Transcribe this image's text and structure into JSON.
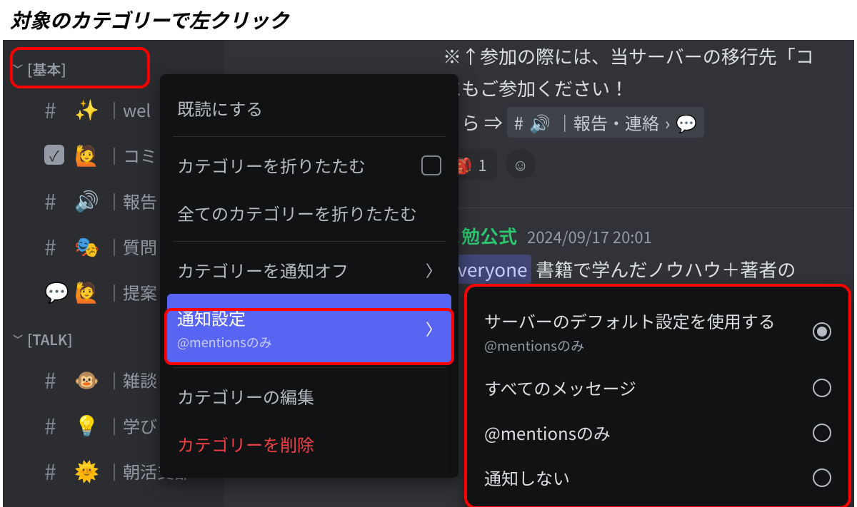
{
  "instruction": "対象のカテゴリーで左クリック",
  "sidebar": {
    "categories": [
      {
        "name": "[基本]",
        "channels": [
          {
            "type": "hash",
            "emoji": "✨",
            "label": "wel"
          },
          {
            "type": "check",
            "emoji": "🙋",
            "label": "コミ"
          },
          {
            "type": "hash",
            "emoji": "🔊",
            "label": "報告"
          },
          {
            "type": "hash",
            "emoji": "🎭",
            "label": "質問"
          },
          {
            "type": "thread",
            "emoji": "🙋",
            "label": "提案"
          }
        ]
      },
      {
        "name": "[TALK]",
        "channels": [
          {
            "type": "hash",
            "emoji": "🐵",
            "label": "雑談"
          },
          {
            "type": "hash",
            "emoji": "💡",
            "label": "学び"
          },
          {
            "type": "hash",
            "emoji": "🌞",
            "label": "朝活支部"
          }
        ]
      }
    ]
  },
  "context_menu": {
    "mark_read": "既読にする",
    "collapse_category": "カテゴリーを折りたたむ",
    "collapse_all": "全てのカテゴリーを折りたたむ",
    "mute_category": "カテゴリーを通知オフ",
    "notification_settings": {
      "title": "通知設定",
      "sub": "@mentionsのみ"
    },
    "edit_category": "カテゴリーの編集",
    "delete_category": "カテゴリーを削除"
  },
  "chat": {
    "line1": "※↑参加の際には、当サーバーの移行先「コ",
    "line2": "にもご参加ください！",
    "line3_prefix": "ちら ⇒",
    "mention_channel": "｜報告・連絡",
    "reaction_count": "1",
    "msg_author": "ュ勉公式",
    "msg_time": "2024/09/17 20:01",
    "msg_mention": "everyone",
    "msg_body_rest": " 書籍で学んだノウハウ＋著者の"
  },
  "submenu": {
    "options": [
      {
        "label": "サーバーのデフォルト設定を使用する",
        "sub": "@mentionsのみ",
        "checked": true
      },
      {
        "label": "すべてのメッセージ",
        "checked": false
      },
      {
        "label": "@mentionsのみ",
        "checked": false
      },
      {
        "label": "通知しない",
        "checked": false
      }
    ]
  }
}
